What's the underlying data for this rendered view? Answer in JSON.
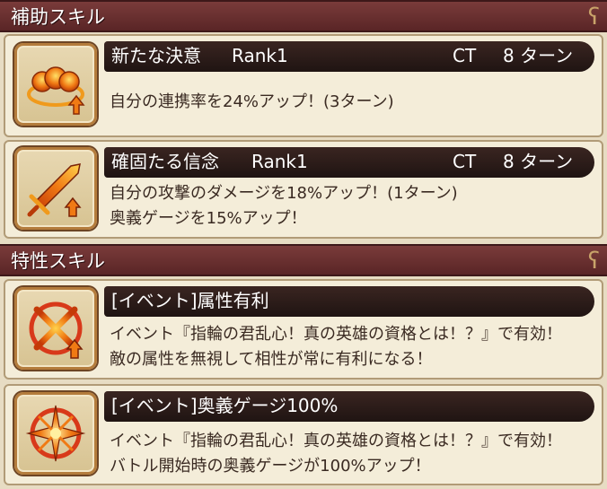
{
  "sections": {
    "support": {
      "title": "補助スキル"
    },
    "trait": {
      "title": "特性スキル"
    }
  },
  "skills": [
    {
      "name": "新たな決意",
      "rank": "Rank1",
      "ct_label": "CT",
      "ct_value": "8 ターン",
      "desc": [
        "自分の連携率を24%アップ！(3ターン)"
      ],
      "icon": "burst-fists-icon"
    },
    {
      "name": "確固たる信念",
      "rank": "Rank1",
      "ct_label": "CT",
      "ct_value": "8 ターン",
      "desc": [
        "自分の攻撃のダメージを18%アップ！(1ターン)",
        "奥義ゲージを15%アップ！"
      ],
      "icon": "sword-up-icon"
    }
  ],
  "traits": [
    {
      "name": "[イベント]属性有利",
      "desc": [
        "イベント『指輪の君乱心！真の英雄の資格とは！？』で有効！",
        "敵の属性を無視して相性が常に有利になる！"
      ],
      "icon": "attribute-advantage-icon"
    },
    {
      "name": "[イベント]奥義ゲージ100%",
      "desc": [
        "イベント『指輪の君乱心！真の英雄の資格とは！？』で有効！",
        "バトル開始時の奥義ゲージが100%アップ！"
      ],
      "icon": "burst-gauge-icon"
    }
  ],
  "colors": {
    "header": "#6b2f30",
    "title_bar": "#2a1a17",
    "icon_orange": "#f07a14"
  }
}
